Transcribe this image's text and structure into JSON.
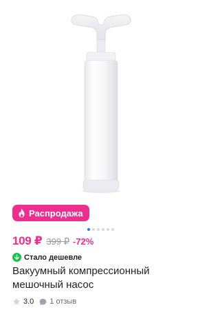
{
  "product": {
    "badge": {
      "label": "Распродажа",
      "icon": "flame-icon",
      "color": "#ef2d8e"
    },
    "gallery": {
      "image": "white vacuum hand pump",
      "dot_count": 6,
      "active_dot": 0
    },
    "price": {
      "current": "109 ₽",
      "old": "399 ₽",
      "discount": "-72%"
    },
    "cheaper_label": "Стало дешевле",
    "title": "Вакуумный компрессионный мешочный насос",
    "rating": {
      "value": "3.0",
      "reviews": "1 отзыв"
    }
  },
  "colors": {
    "accent": "#ef2d8e",
    "success": "#10c44c",
    "active_dot": "#1e78ff"
  }
}
